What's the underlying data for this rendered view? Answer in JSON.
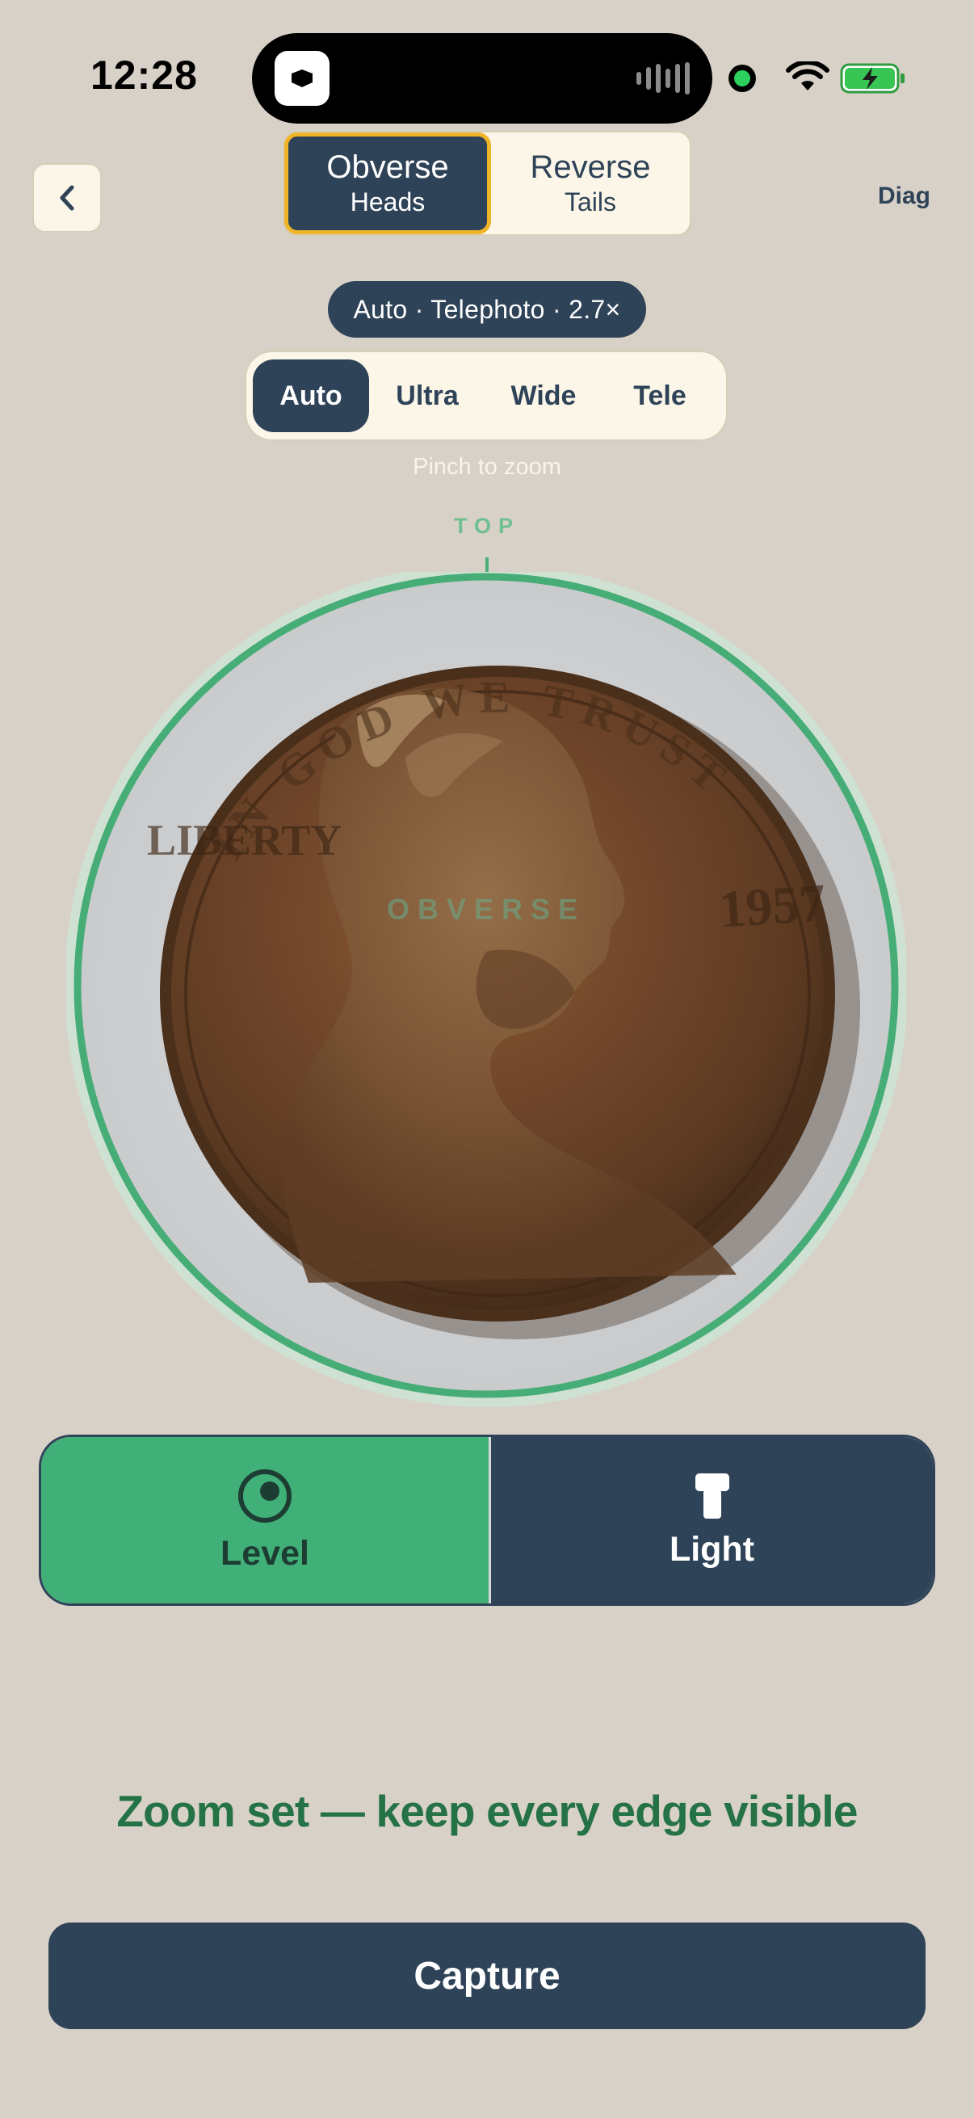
{
  "status_bar": {
    "time": "12:28",
    "icons": [
      "app-icon",
      "audio-wave-icon",
      "camera-indicator-icon",
      "wifi-icon",
      "battery-charging-icon"
    ]
  },
  "header": {
    "back_icon": "chevron-left-icon",
    "side_toggle": [
      {
        "label": "Obverse",
        "sublabel": "Heads",
        "active": true
      },
      {
        "label": "Reverse",
        "sublabel": "Tails",
        "active": false
      }
    ],
    "diag_label": "Diag"
  },
  "camera": {
    "badge": "Auto · Telephoto · 2.7×",
    "lenses": [
      "Auto",
      "Ultra",
      "Wide",
      "Tele"
    ],
    "selected_lens": "Auto",
    "hint": "Pinch to zoom"
  },
  "viewfinder": {
    "top_label": "TOP",
    "side_watermark": "OBVERSE",
    "coin_inscriptions": {
      "motto": "IN GOD WE TRUST",
      "word_left": "LIBERTY",
      "year": "1957"
    },
    "guide_color": "#46ad76"
  },
  "controls": {
    "level": {
      "label": "Level",
      "icon": "level-target-icon",
      "active": true
    },
    "light": {
      "label": "Light",
      "icon": "flashlight-icon",
      "active": false
    }
  },
  "status_message": "Zoom set — keep every edge visible",
  "capture_label": "Capture",
  "colors": {
    "background": "#d8d1c7",
    "primary": "#2f4358",
    "accent": "#40b078",
    "highlight": "#f0b429",
    "success_text": "#247245"
  }
}
